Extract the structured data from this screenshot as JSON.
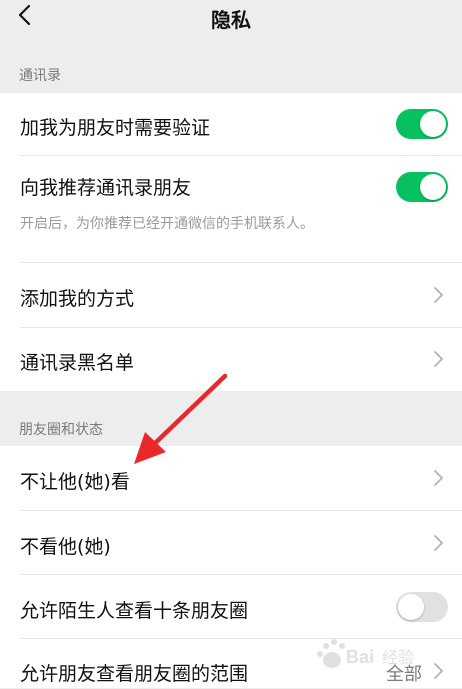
{
  "header": {
    "title": "隐私",
    "back_icon": "chevron-left-icon"
  },
  "sections": {
    "contacts": {
      "label": "通讯录",
      "verify": {
        "label": "加我为朋友时需要验证",
        "enabled": true
      },
      "recommend": {
        "label": "向我推荐通讯录朋友",
        "enabled": true,
        "hint": "开启后，为你推荐已经开通微信的手机联系人。"
      },
      "add_methods": {
        "label": "添加我的方式"
      },
      "blacklist": {
        "label": "通讯录黑名单"
      }
    },
    "moments": {
      "label": "朋友圈和状态",
      "hide_from": {
        "label": "不让他(她)看"
      },
      "dont_see": {
        "label": "不看他(她)"
      },
      "strangers": {
        "label": "允许陌生人查看十条朋友圈",
        "enabled": false
      },
      "range": {
        "label": "允许朋友查看朋友圈的范围",
        "value": "全部"
      }
    }
  },
  "colors": {
    "toggle_on": "#07c160",
    "toggle_off": "#e1e1e1",
    "annotation_arrow": "#e8282b"
  },
  "annotation": {
    "type": "red-arrow",
    "points_to": "不让他(她)看"
  }
}
